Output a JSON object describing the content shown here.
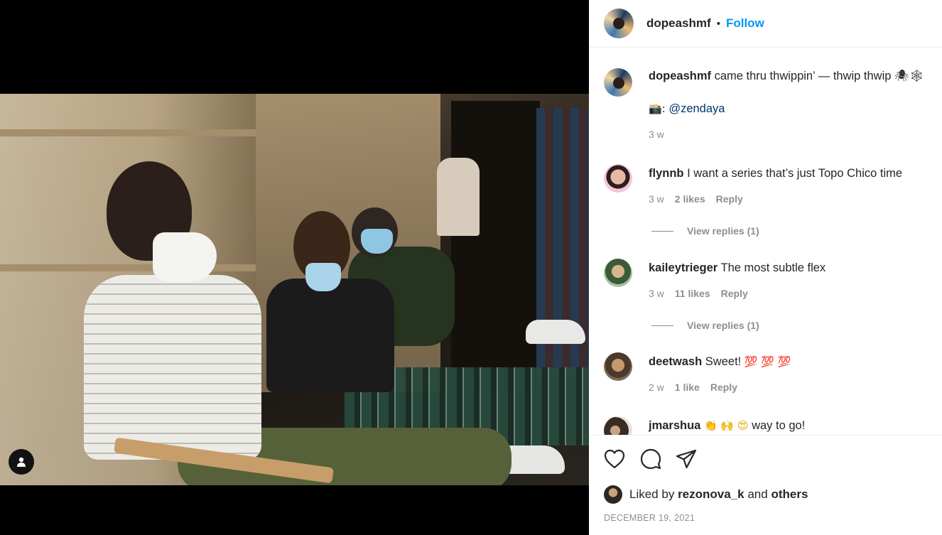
{
  "post": {
    "username": "dopeashmf",
    "follow_label": "Follow",
    "dot": "•"
  },
  "caption": {
    "username": "dopeashmf",
    "text": "came thru thwippin’ — thwip thwip 🕷🕸",
    "camera_emoji": "📸:",
    "mention": "@zendaya",
    "time": "3 w"
  },
  "comments": [
    {
      "username": "flynnb",
      "text": "I want a series that’s just Topo Chico time",
      "time": "3 w",
      "likes": "2 likes",
      "reply": "Reply",
      "view_replies": "View replies (1)"
    },
    {
      "username": "kaileytrieger",
      "text": "The most subtle flex",
      "time": "3 w",
      "likes": "11 likes",
      "reply": "Reply",
      "view_replies": "View replies (1)"
    },
    {
      "username": "deetwash",
      "text": "Sweet!",
      "emoji": "💯 💯 💯",
      "time": "2 w",
      "likes": "1 like",
      "reply": "Reply"
    },
    {
      "username": "jmarshua",
      "emoji": "👏 🙌 😍",
      "text": "way to go!"
    }
  ],
  "likes": {
    "prefix": "Liked by",
    "user": "rezonova_k",
    "and": "and",
    "others": "others"
  },
  "date": "DECEMBER 19, 2021",
  "icons": [
    "heart-icon",
    "comment-icon",
    "share-icon",
    "user-tag-icon"
  ],
  "colors": {
    "accent": "#0095f6",
    "mention": "#00376b",
    "meta": "#8e8e8e",
    "text": "#262626"
  }
}
